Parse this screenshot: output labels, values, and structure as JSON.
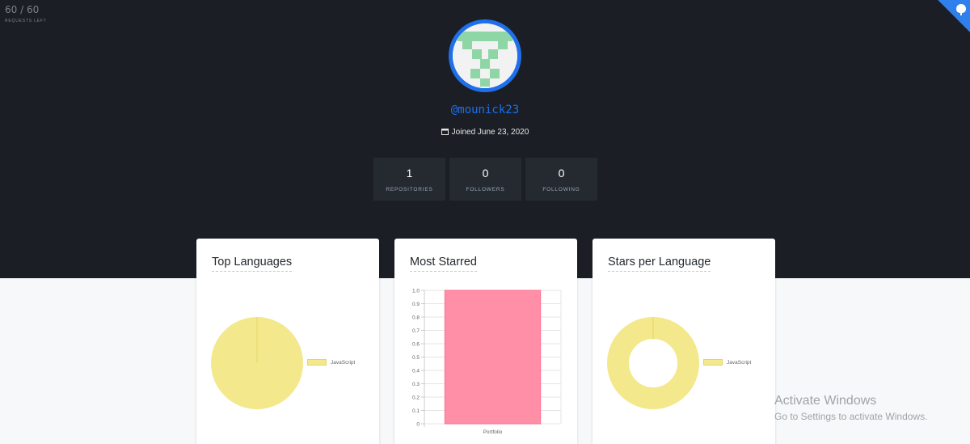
{
  "rate_limit": {
    "count": "60 / 60",
    "label": "REQUESTS LEFT"
  },
  "profile": {
    "username": "@mounick23",
    "joined": "Joined June 23, 2020"
  },
  "stats": [
    {
      "value": "1",
      "label": "REPOSITORIES"
    },
    {
      "value": "0",
      "label": "FOLLOWERS"
    },
    {
      "value": "0",
      "label": "FOLLOWING"
    }
  ],
  "cards": {
    "top_languages": {
      "title": "Top Languages",
      "legend": "JavaScript"
    },
    "most_starred": {
      "title": "Most Starred"
    },
    "stars_per_language": {
      "title": "Stars per Language",
      "legend": "JavaScript"
    }
  },
  "chart_data": [
    {
      "type": "pie",
      "title": "Top Languages",
      "labels": [
        "JavaScript"
      ],
      "values": [
        1
      ],
      "colors": [
        "#f3e88c"
      ]
    },
    {
      "type": "bar",
      "title": "Most Starred",
      "categories": [
        "Portfolio"
      ],
      "values": [
        1
      ],
      "ylim": [
        0,
        1
      ],
      "yticks": [
        "1.0",
        "0.9",
        "0.8",
        "0.7",
        "0.6",
        "0.5",
        "0.4",
        "0.3",
        "0.2",
        "0.1",
        "0"
      ],
      "colors": [
        "#ff8fa7"
      ]
    },
    {
      "type": "pie",
      "title": "Stars per Language",
      "labels": [
        "JavaScript"
      ],
      "values": [
        1
      ],
      "colors": [
        "#f3e88c"
      ]
    }
  ],
  "watermark": {
    "title": "Activate Windows",
    "subtitle": "Go to Settings to activate Windows."
  },
  "colors": {
    "header_bg": "#1b1f25",
    "accent": "#1f6feb",
    "stat_bg": "#252a31",
    "pie": "#f3e88c",
    "bar": "#ff8fa7"
  }
}
